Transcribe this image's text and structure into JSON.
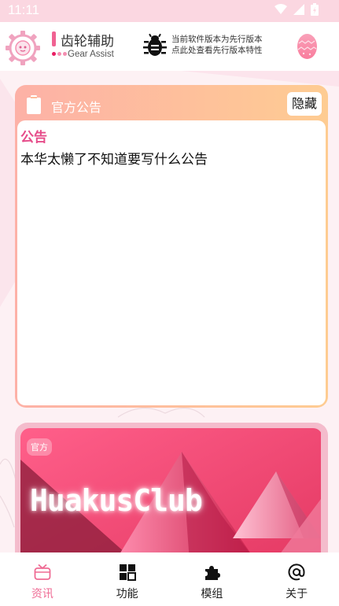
{
  "status_bar": {
    "time": "11:11"
  },
  "header": {
    "app_title": "齿轮辅助",
    "app_subtitle": "Gear Assist",
    "version_note_line1": "当前软件版本为先行版本",
    "version_note_line2": "点此处查看先行版本特性"
  },
  "notice_card": {
    "title": "官方公告",
    "hide_label": "隐藏",
    "heading": "公告",
    "body": "本华太懒了不知道要写什么公告"
  },
  "banner": {
    "badge": "官方",
    "text": "HuakusClub"
  },
  "bottom_nav": {
    "items": [
      {
        "label": "资讯",
        "icon": "tv-icon",
        "active": true
      },
      {
        "label": "功能",
        "icon": "grid-icon",
        "active": false
      },
      {
        "label": "模组",
        "icon": "puzzle-icon",
        "active": false
      },
      {
        "label": "关于",
        "icon": "at-icon",
        "active": false
      }
    ]
  },
  "colors": {
    "accent": "#ef6b94",
    "card_gradient_start": "#fdb1a7",
    "card_gradient_end": "#fecc92",
    "status_bar": "#fbd7e1"
  }
}
